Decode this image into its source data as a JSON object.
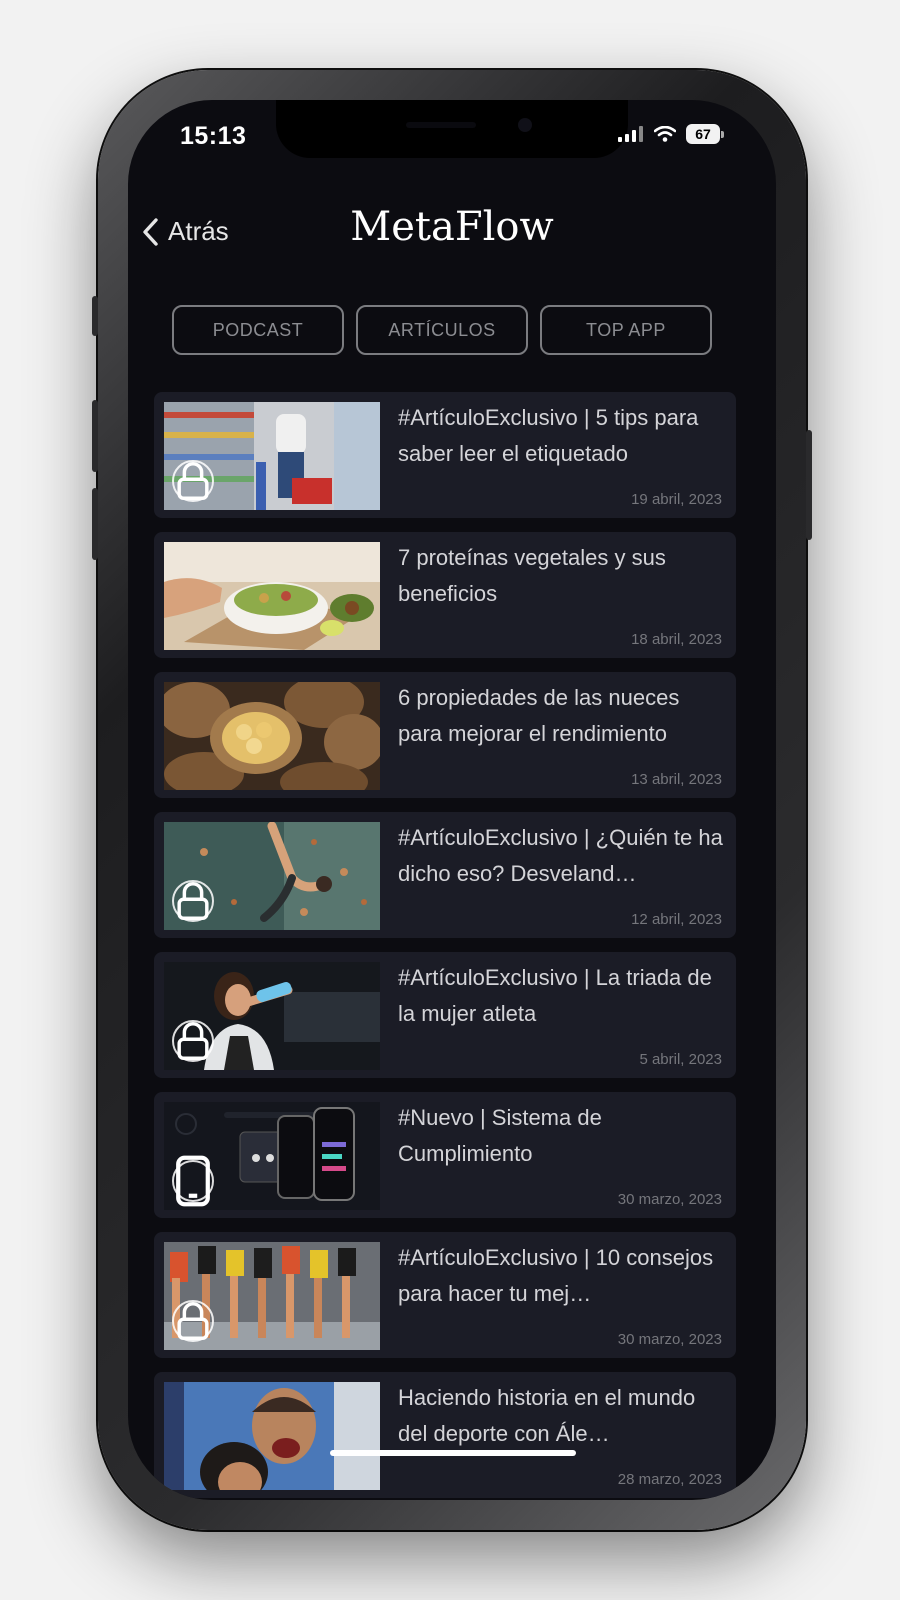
{
  "status": {
    "time": "15:13",
    "battery": "67"
  },
  "nav": {
    "back_label": "Atrás",
    "title": "MetaFlow"
  },
  "tabs": [
    "PODCAST",
    "ARTÍCULOS",
    "TOP APP"
  ],
  "articles": [
    {
      "title": "#ArtículoExclusivo | 5 tips para saber leer el etiquetado",
      "date": "19 abril, 2023"
    },
    {
      "title": "7 proteínas vegetales y sus beneficios",
      "date": "18 abril, 2023"
    },
    {
      "title": "6 propiedades de las nueces para mejorar el rendimiento",
      "date": "13 abril, 2023"
    },
    {
      "title": "#ArtículoExclusivo | ¿Quién te ha dicho eso? Desveland…",
      "date": "12 abril, 2023"
    },
    {
      "title": "#ArtículoExclusivo | La triada de la mujer atleta",
      "date": "5 abril, 2023"
    },
    {
      "title": "#Nuevo | Sistema de Cumplimiento",
      "date": "30 marzo, 2023"
    },
    {
      "title": "#ArtículoExclusivo | 10 consejos para hacer tu mej…",
      "date": "30 marzo, 2023"
    },
    {
      "title": "Haciendo historia en el mundo del deporte con Ále…",
      "date": "28 marzo, 2023"
    }
  ]
}
